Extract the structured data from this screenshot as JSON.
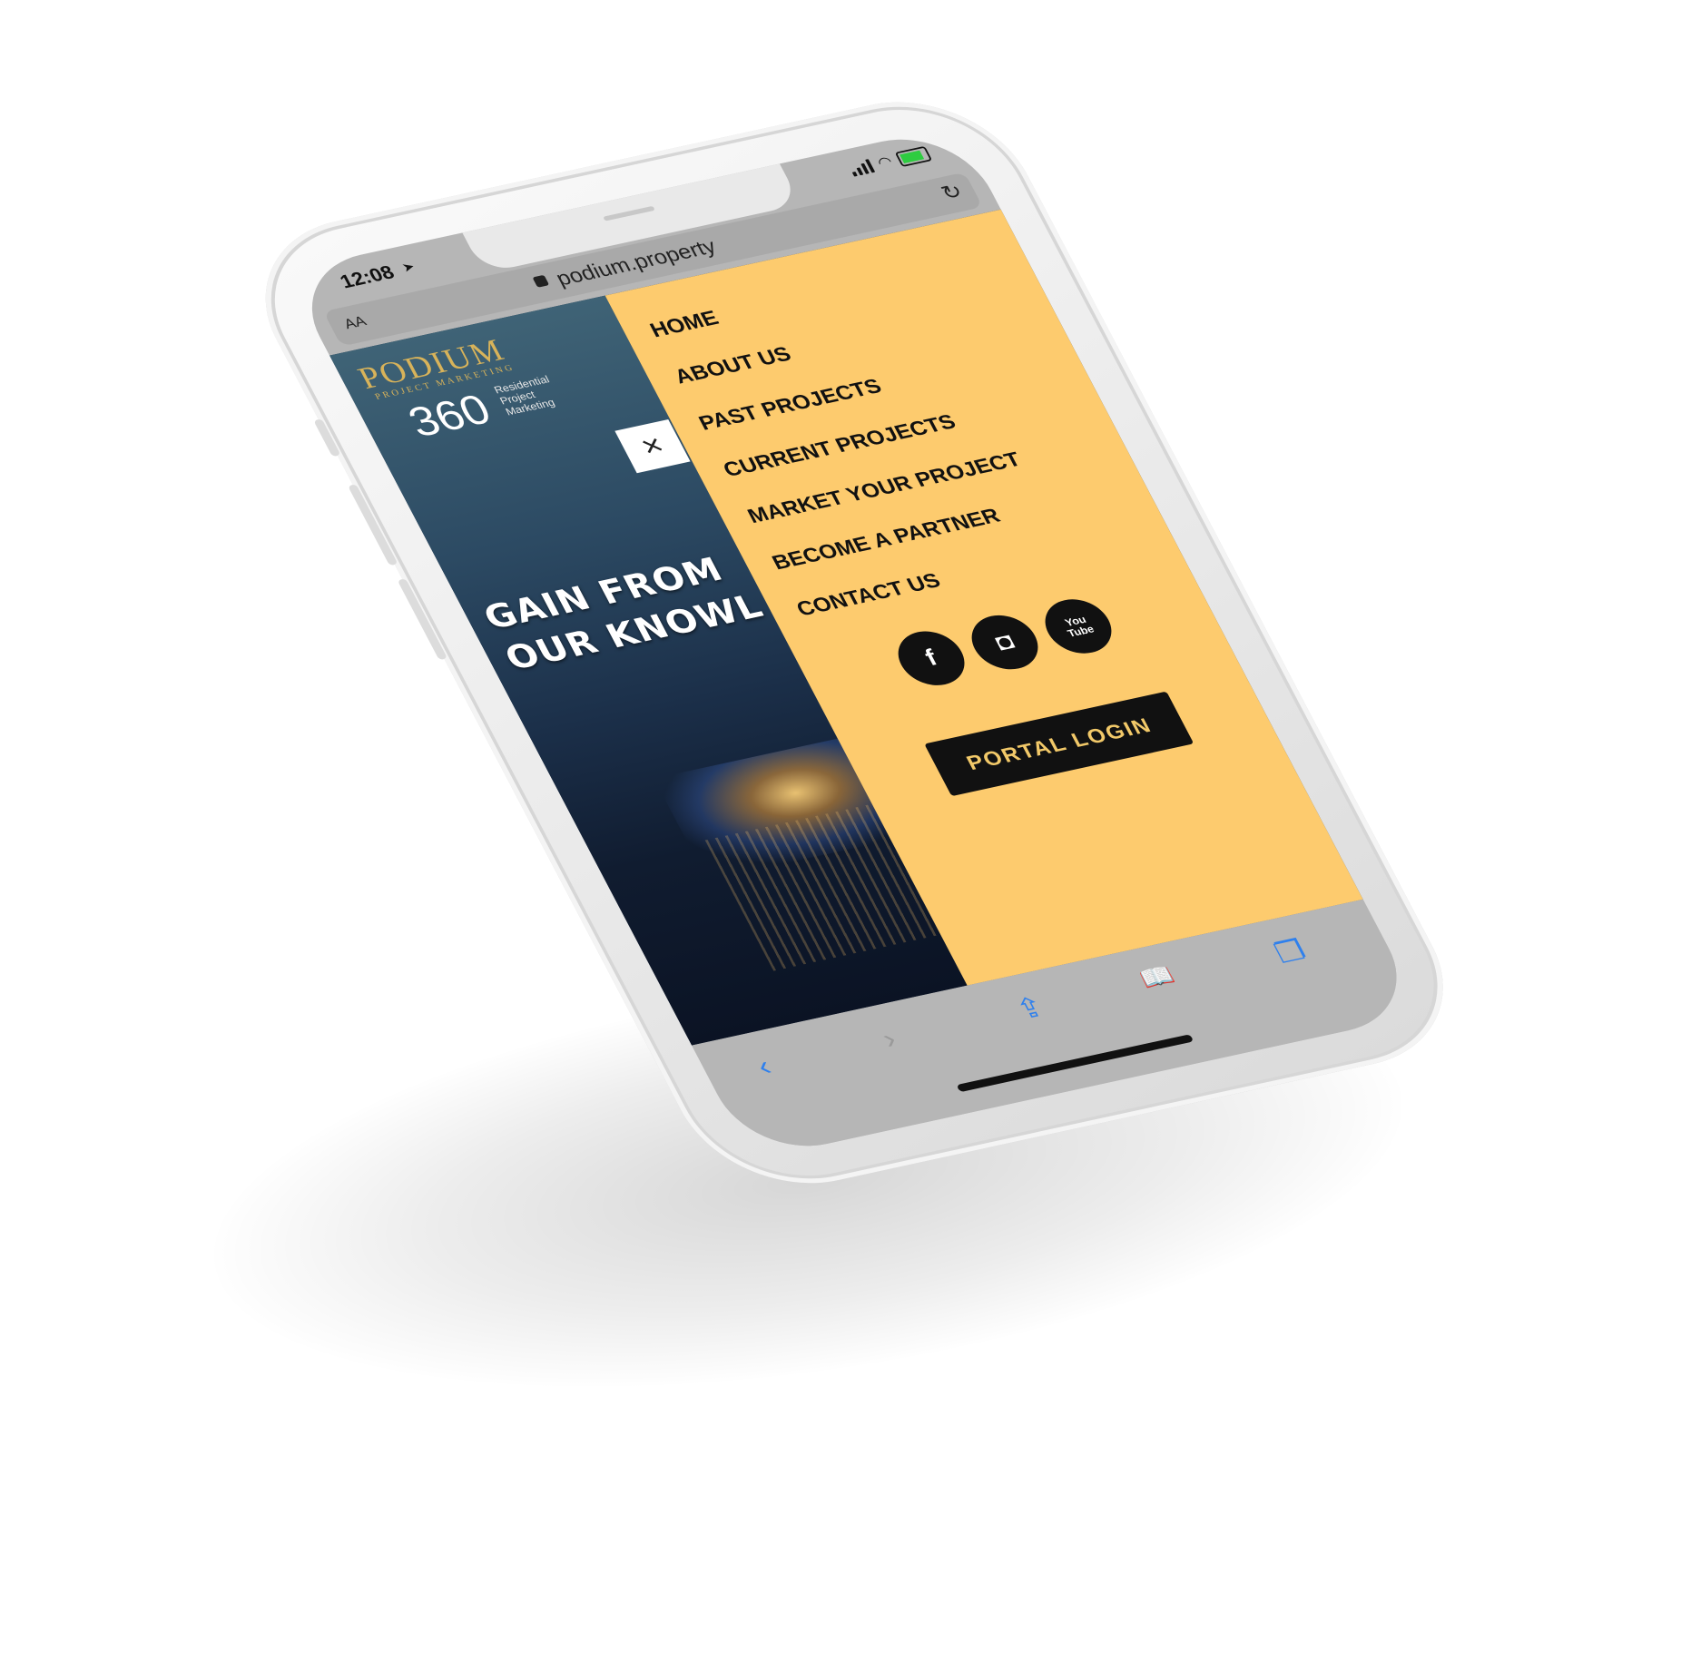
{
  "status_bar": {
    "time": "12:08",
    "location_icon": "location-arrow-icon",
    "signal_icon": "signal-icon",
    "wifi_icon": "wifi-icon",
    "battery_icon": "battery-charging-icon"
  },
  "browser": {
    "text_size_label": "AA",
    "url": "podium.property",
    "reload_icon": "reload-icon",
    "lock_icon": "lock-icon"
  },
  "hero": {
    "logo_title": "PODIUM",
    "logo_subtitle": "PROJECT MARKETING",
    "logo_number": "360",
    "logo_side_text": "Residential\nProject\nMarketing",
    "close_icon": "×",
    "tagline": "GAIN FROM\nOUR KNOWL"
  },
  "menu": {
    "items": [
      {
        "label": "HOME"
      },
      {
        "label": "ABOUT US"
      },
      {
        "label": "PAST PROJECTS"
      },
      {
        "label": "CURRENT PROJECTS"
      },
      {
        "label": "MARKET YOUR PROJECT"
      },
      {
        "label": "BECOME A PARTNER"
      },
      {
        "label": "CONTACT US"
      }
    ],
    "social": {
      "facebook": "f",
      "instagram": "◘",
      "youtube": "You\nTube"
    },
    "portal_login": "PORTAL LOGIN",
    "accent_color": "#fdcb6e"
  },
  "toolbar": {
    "back": "‹",
    "forward": "›",
    "share": "⇪",
    "bookmarks": "📖",
    "tabs": "❐",
    "button_color": "#2f80ed"
  }
}
